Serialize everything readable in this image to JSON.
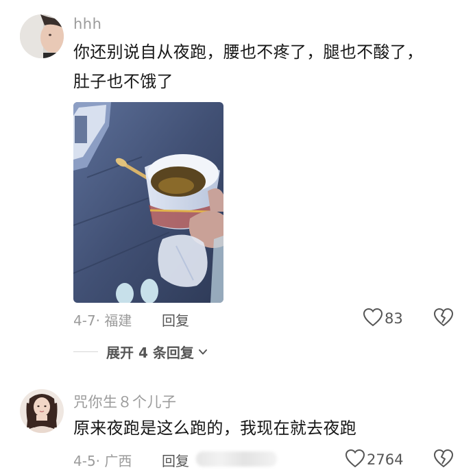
{
  "comments": [
    {
      "username": "hhh",
      "lines": [
        "你还别说自从夜跑，腰也不疼了，腿也不酸了，",
        "肚子也不饿了"
      ],
      "date_location": "4-7· 福建",
      "reply_label": "回复",
      "likes": "83",
      "expand_label": "展开 4 条回复"
    },
    {
      "username": "咒你生８个儿子",
      "lines": [
        "原来夜跑是这么跑的，我现在就去夜跑"
      ],
      "date_location": "4-5· 广西",
      "reply_label": "回复",
      "likes": "2764"
    }
  ],
  "icons": {
    "like": "heart-outline-icon",
    "dislike": "broken-heart-icon",
    "expand": "chevron-down-icon"
  },
  "colors": {
    "text": "#161616",
    "secondary": "#9b9b9b",
    "action": "#555555"
  }
}
